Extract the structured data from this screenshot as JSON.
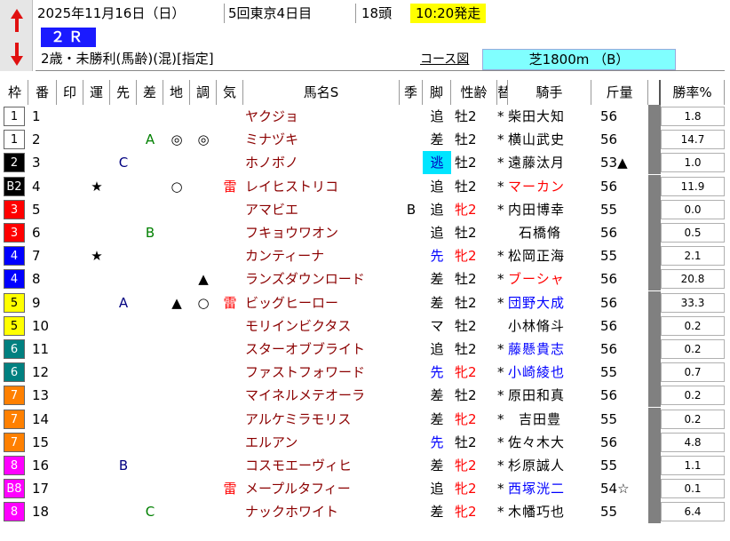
{
  "header": {
    "date": "2025年11月16日（日）",
    "meeting": "5回東京4日目",
    "runners": "18頭",
    "start_time": "10:20発走",
    "race_no": "２Ｒ",
    "condition": "2歳・未勝利(馬齢)(混)[指定]",
    "course_label": "コース図",
    "course": "芝1800m （B）"
  },
  "nav": {
    "up": "arrow-up-icon",
    "down": "arrow-down-icon"
  },
  "columns": [
    "枠",
    "番",
    "印",
    "運",
    "先",
    "差",
    "地",
    "調",
    "気",
    "馬名S",
    "季",
    "脚",
    "性齢",
    "替",
    "騎手",
    "斤量",
    "",
    "勝率%"
  ],
  "colors": {
    "w1": "#ffffff",
    "w2": "#000000",
    "w3": "#ff0000",
    "w4": "#0000ff",
    "w5": "#ffff00",
    "w6": "#008080",
    "w7": "#ff8000",
    "w8": "#ff00ff",
    "horse_name": "#8b0000",
    "start_time_bg": "#ffff00",
    "race_badge": "#1a1aff",
    "course_bg": "#80ffff"
  },
  "rows": [
    {
      "waku": "1",
      "num": "1",
      "name": "ヤクジョ",
      "kisetsu": "",
      "kyaku": "追",
      "sexage": "牡2",
      "kae": "*",
      "jockey": "柴田大知",
      "kin": "56",
      "rate": "1.8",
      "in": "",
      "un": "",
      "saki": "",
      "sa": "",
      "chi": "",
      "cho": "",
      "ki": ""
    },
    {
      "waku": "1",
      "num": "2",
      "name": "ミナヅキ",
      "kisetsu": "",
      "kyaku": "差",
      "sexage": "牡2",
      "kae": "*",
      "jockey": "横山武史",
      "kin": "56",
      "rate": "14.7",
      "in": "",
      "un": "",
      "saki": "",
      "sa": "A",
      "chi": "◎",
      "cho": "◎",
      "ki": ""
    },
    {
      "waku": "2",
      "num": "3",
      "name": "ホノボノ",
      "kisetsu": "",
      "kyaku": "逃",
      "sexage": "牡2",
      "kae": "*",
      "jockey": "遠藤汰月",
      "kin": "53▲",
      "rate": "1.0",
      "in": "",
      "un": "",
      "saki": "C",
      "sa": "",
      "chi": "",
      "cho": "",
      "ki": ""
    },
    {
      "waku": "B2",
      "num": "4",
      "name": "レイヒストリコ",
      "kisetsu": "",
      "kyaku": "追",
      "sexage": "牡2",
      "kae": "*",
      "jockey": "マーカン",
      "kin": "56",
      "rate": "11.9",
      "in": "",
      "un": "★",
      "saki": "",
      "sa": "",
      "chi": "○",
      "cho": "",
      "ki": "雷"
    },
    {
      "waku": "3",
      "num": "5",
      "name": "アマビエ",
      "kisetsu": "B",
      "kyaku": "追",
      "sexage": "牝2",
      "kae": "*",
      "jockey": "内田博幸",
      "kin": "55",
      "rate": "0.0",
      "in": "",
      "un": "",
      "saki": "",
      "sa": "",
      "chi": "",
      "cho": "",
      "ki": ""
    },
    {
      "waku": "3",
      "num": "6",
      "name": "フキョウワオン",
      "kisetsu": "",
      "kyaku": "追",
      "sexage": "牡2",
      "kae": "",
      "jockey": "石橋脩",
      "kin": "56",
      "rate": "0.5",
      "in": "",
      "un": "",
      "saki": "",
      "sa": "B",
      "chi": "",
      "cho": "",
      "ki": ""
    },
    {
      "waku": "4",
      "num": "7",
      "name": "カンティーナ",
      "kisetsu": "",
      "kyaku": "先",
      "sexage": "牝2",
      "kae": "*",
      "jockey": "松岡正海",
      "kin": "55",
      "rate": "2.1",
      "in": "",
      "un": "★",
      "saki": "",
      "sa": "",
      "chi": "",
      "cho": "",
      "ki": ""
    },
    {
      "waku": "4",
      "num": "8",
      "name": "ランズダウンロード",
      "kisetsu": "",
      "kyaku": "差",
      "sexage": "牡2",
      "kae": "*",
      "jockey": "ブーシャ",
      "kin": "56",
      "rate": "20.8",
      "in": "",
      "un": "",
      "saki": "",
      "sa": "",
      "chi": "",
      "cho": "▲",
      "ki": ""
    },
    {
      "waku": "5",
      "num": "9",
      "name": "ビッグヒーロー",
      "kisetsu": "",
      "kyaku": "差",
      "sexage": "牡2",
      "kae": "*",
      "jockey": "団野大成",
      "kin": "56",
      "rate": "33.3",
      "in": "",
      "un": "",
      "saki": "A",
      "sa": "",
      "chi": "▲",
      "cho": "○",
      "ki": "雷"
    },
    {
      "waku": "5",
      "num": "10",
      "name": "モリインビクタス",
      "kisetsu": "",
      "kyaku": "マ",
      "sexage": "牡2",
      "kae": "",
      "jockey": "小林脩斗",
      "kin": "56",
      "rate": "0.2",
      "in": "",
      "un": "",
      "saki": "",
      "sa": "",
      "chi": "",
      "cho": "",
      "ki": ""
    },
    {
      "waku": "6",
      "num": "11",
      "name": "スターオブブライト",
      "kisetsu": "",
      "kyaku": "追",
      "sexage": "牡2",
      "kae": "*",
      "jockey": "藤懸貴志",
      "kin": "56",
      "rate": "0.2",
      "in": "",
      "un": "",
      "saki": "",
      "sa": "",
      "chi": "",
      "cho": "",
      "ki": ""
    },
    {
      "waku": "6",
      "num": "12",
      "name": "ファストフォワード",
      "kisetsu": "",
      "kyaku": "先",
      "sexage": "牝2",
      "kae": "*",
      "jockey": "小崎綾也",
      "kin": "55",
      "rate": "0.7",
      "in": "",
      "un": "",
      "saki": "",
      "sa": "",
      "chi": "",
      "cho": "",
      "ki": ""
    },
    {
      "waku": "7",
      "num": "13",
      "name": "マイネルメテオーラ",
      "kisetsu": "",
      "kyaku": "差",
      "sexage": "牡2",
      "kae": "*",
      "jockey": "原田和真",
      "kin": "56",
      "rate": "0.2",
      "in": "",
      "un": "",
      "saki": "",
      "sa": "",
      "chi": "",
      "cho": "",
      "ki": ""
    },
    {
      "waku": "7",
      "num": "14",
      "name": "アルケミラモリス",
      "kisetsu": "",
      "kyaku": "差",
      "sexage": "牝2",
      "kae": "*",
      "jockey": "吉田豊",
      "kin": "55",
      "rate": "0.2",
      "in": "",
      "un": "",
      "saki": "",
      "sa": "",
      "chi": "",
      "cho": "",
      "ki": ""
    },
    {
      "waku": "7",
      "num": "15",
      "name": "エルアン",
      "kisetsu": "",
      "kyaku": "先",
      "sexage": "牡2",
      "kae": "*",
      "jockey": "佐々木大",
      "kin": "56",
      "rate": "4.8",
      "in": "",
      "un": "",
      "saki": "",
      "sa": "",
      "chi": "",
      "cho": "",
      "ki": ""
    },
    {
      "waku": "8",
      "num": "16",
      "name": "コスモエーヴィヒ",
      "kisetsu": "",
      "kyaku": "差",
      "sexage": "牝2",
      "kae": "*",
      "jockey": "杉原誠人",
      "kin": "55",
      "rate": "1.1",
      "in": "",
      "un": "",
      "saki": "B",
      "sa": "",
      "chi": "",
      "cho": "",
      "ki": ""
    },
    {
      "waku": "B8",
      "num": "17",
      "name": "メープルタフィー",
      "kisetsu": "",
      "kyaku": "追",
      "sexage": "牝2",
      "kae": "*",
      "jockey": "西塚洸二",
      "kin": "54☆",
      "rate": "0.1",
      "in": "",
      "un": "",
      "saki": "",
      "sa": "",
      "chi": "",
      "cho": "",
      "ki": "雷"
    },
    {
      "waku": "8",
      "num": "18",
      "name": "ナックホワイト",
      "kisetsu": "",
      "kyaku": "差",
      "sexage": "牝2",
      "kae": "*",
      "jockey": "木幡巧也",
      "kin": "55",
      "rate": "6.4",
      "in": "",
      "un": "",
      "saki": "",
      "sa": "C",
      "chi": "",
      "cho": "",
      "ki": ""
    }
  ]
}
